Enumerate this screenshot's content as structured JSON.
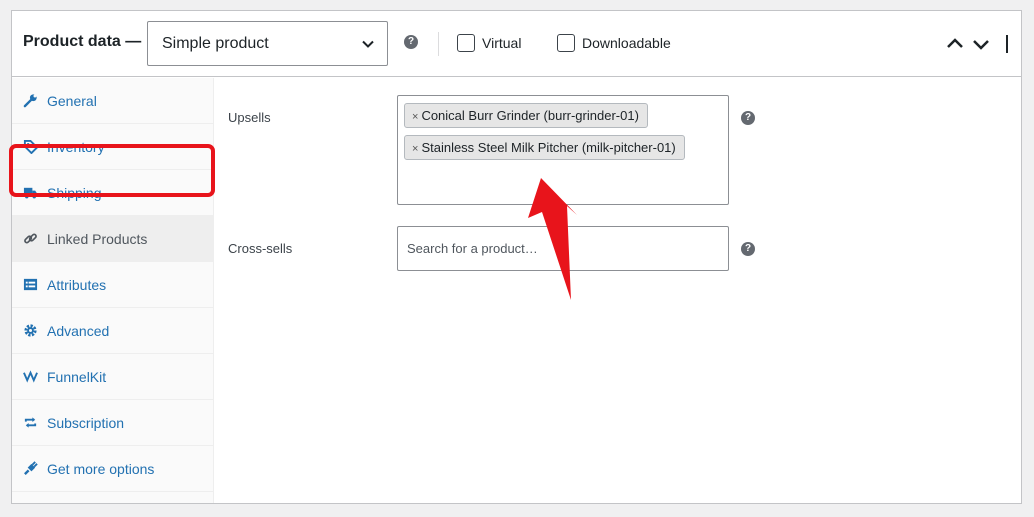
{
  "header": {
    "title": "Product data —",
    "product_type": "Simple product",
    "virtual_label": "Virtual",
    "downloadable_label": "Downloadable"
  },
  "sidebar": {
    "items": [
      {
        "label": "General",
        "icon": "wrench-icon"
      },
      {
        "label": "Inventory",
        "icon": "tag-icon"
      },
      {
        "label": "Shipping",
        "icon": "truck-icon"
      },
      {
        "label": "Linked Products",
        "icon": "link-icon",
        "active": true
      },
      {
        "label": "Attributes",
        "icon": "list-icon"
      },
      {
        "label": "Advanced",
        "icon": "gear-icon"
      },
      {
        "label": "FunnelKit",
        "icon": "funnelkit-icon"
      },
      {
        "label": "Subscription",
        "icon": "repeat-icon"
      },
      {
        "label": "Get more options",
        "icon": "plugin-icon"
      }
    ]
  },
  "linked": {
    "upsells_label": "Upsells",
    "upsells": [
      "Conical Burr Grinder (burr-grinder-01)",
      "Stainless Steel Milk Pitcher (milk-pitcher-01)"
    ],
    "remove_symbol": "×",
    "crosssells_label": "Cross-sells",
    "crosssells_placeholder": "Search for a product…"
  },
  "colors": {
    "link": "#2271b1",
    "highlight": "#e8141b",
    "border": "#c3c4c7"
  }
}
